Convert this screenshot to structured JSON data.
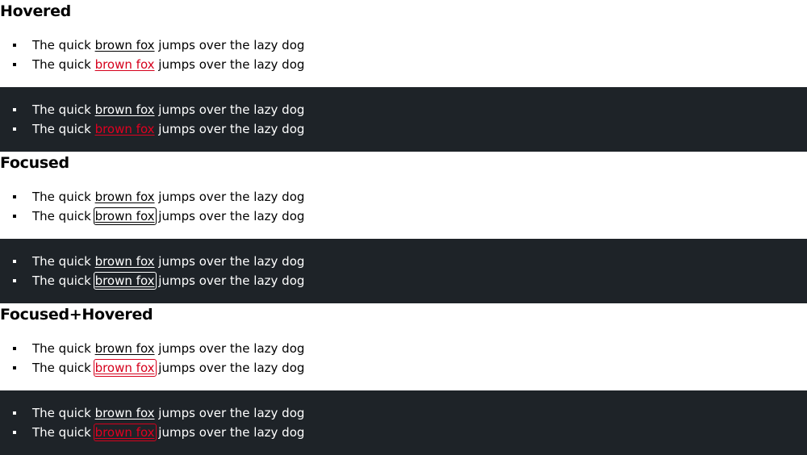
{
  "sections": [
    {
      "heading": "Hovered",
      "light": {
        "item1": {
          "before": "The quick ",
          "link": "brown fox",
          "after": " jumps over the lazy dog"
        },
        "item2": {
          "before": "The quick ",
          "link": "brown fox",
          "after": " jumps over the lazy dog"
        }
      },
      "dark": {
        "item1": {
          "before": "The quick ",
          "link": "brown fox",
          "after": " jumps over the lazy dog"
        },
        "item2": {
          "before": "The quick ",
          "link": "brown fox",
          "after": " jumps over the lazy dog"
        }
      }
    },
    {
      "heading": "Focused",
      "light": {
        "item1": {
          "before": "The quick ",
          "link": "brown fox",
          "after": " jumps over the lazy dog"
        },
        "item2": {
          "before": "The quick ",
          "link": "brown fox",
          "after": " jumps over the lazy dog"
        }
      },
      "dark": {
        "item1": {
          "before": "The quick ",
          "link": "brown fox",
          "after": " jumps over the lazy dog"
        },
        "item2": {
          "before": "The quick ",
          "link": "brown fox",
          "after": " jumps over the lazy dog"
        }
      }
    },
    {
      "heading": "Focused+Hovered",
      "light": {
        "item1": {
          "before": "The quick ",
          "link": "brown fox",
          "after": " jumps over the lazy dog"
        },
        "item2": {
          "before": "The quick ",
          "link": "brown fox",
          "after": " jumps over the lazy dog"
        }
      },
      "dark": {
        "item1": {
          "before": "The quick ",
          "link": "brown fox",
          "after": " jumps over the lazy dog"
        },
        "item2": {
          "before": "The quick ",
          "link": "brown fox",
          "after": " jumps over the lazy dog"
        }
      }
    }
  ],
  "colors": {
    "dark_background": "#1e2328",
    "hover_red": "#d5001c",
    "text_light_theme": "#000000",
    "text_dark_theme": "#ffffff"
  }
}
